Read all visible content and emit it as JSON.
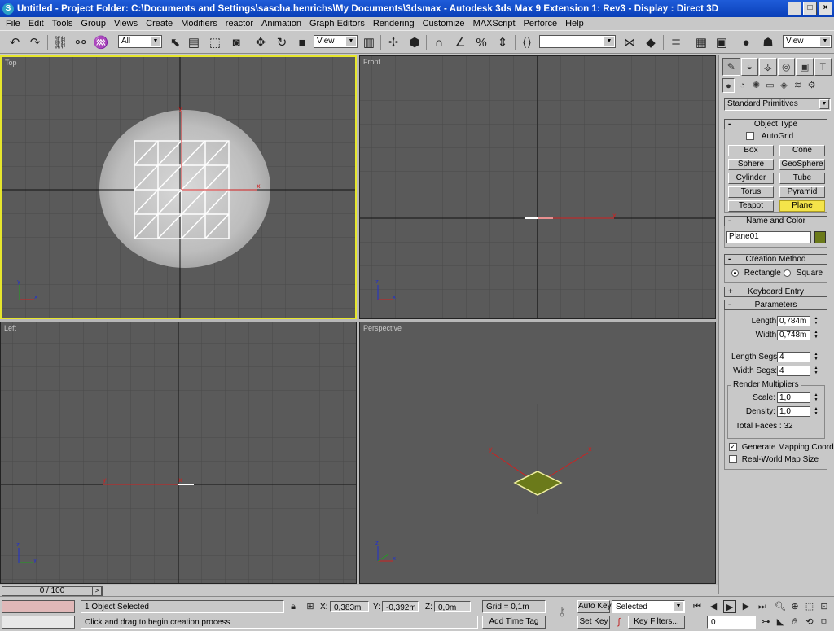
{
  "window": {
    "title": "Untitled      - Project Folder: C:\\Documents and Settings\\sascha.henrichs\\My Documents\\3dsmax      - Autodesk 3ds Max 9 Extension 1: Rev3      - Display : Direct 3D",
    "minimize": "_",
    "maximize": "□",
    "close": "×"
  },
  "menu": [
    "File",
    "Edit",
    "Tools",
    "Group",
    "Views",
    "Create",
    "Modifiers",
    "reactor",
    "Animation",
    "Graph Editors",
    "Rendering",
    "Customize",
    "MAXScript",
    "Perforce",
    "Help"
  ],
  "toolbar": {
    "selection_filter": "All",
    "ref_coord": "View",
    "named_sel": "",
    "view_right": "View"
  },
  "viewports": {
    "top": "Top",
    "front": "Front",
    "left": "Left",
    "perspective": "Perspective"
  },
  "command_panel": {
    "category": "Standard Primitives",
    "object_type": {
      "header": "Object Type",
      "autogrid": "AutoGrid",
      "buttons": [
        "Box",
        "Cone",
        "Sphere",
        "GeoSphere",
        "Cylinder",
        "Tube",
        "Torus",
        "Pyramid",
        "Teapot",
        "Plane"
      ],
      "active": "Plane"
    },
    "name_color": {
      "header": "Name and Color",
      "name": "Plane01",
      "color": "#6b7a1a"
    },
    "creation_method": {
      "header": "Creation Method",
      "rectangle": "Rectangle",
      "square": "Square"
    },
    "keyboard_entry": "Keyboard Entry",
    "parameters": {
      "header": "Parameters",
      "length_label": "Length:",
      "length": "0,784m",
      "width_label": "Width:",
      "width": "0,748m",
      "length_segs_label": "Length Segs:",
      "length_segs": "4",
      "width_segs_label": "Width Segs:",
      "width_segs": "4",
      "render_mult": "Render Multipliers",
      "scale_label": "Scale:",
      "scale": "1,0",
      "density_label": "Density:",
      "density": "1,0",
      "total_faces": "Total Faces : 32",
      "gen_mapping": "Generate Mapping Coords.",
      "real_world": "Real-World Map Size"
    }
  },
  "timeline": {
    "frame": "0 / 100"
  },
  "status": {
    "selected": "1 Object Selected",
    "prompt": "Click and drag to begin creation process",
    "x_label": "X:",
    "x": "0,383m",
    "y_label": "Y:",
    "y": "-0,392m",
    "z_label": "Z:",
    "z": "0,0m",
    "grid": "Grid = 0,1m",
    "add_time_tag": "Add Time Tag",
    "auto_key": "Auto Key",
    "set_key": "Set Key",
    "key_mode": "Selected",
    "key_filters": "Key Filters...",
    "frame_field": "0"
  }
}
